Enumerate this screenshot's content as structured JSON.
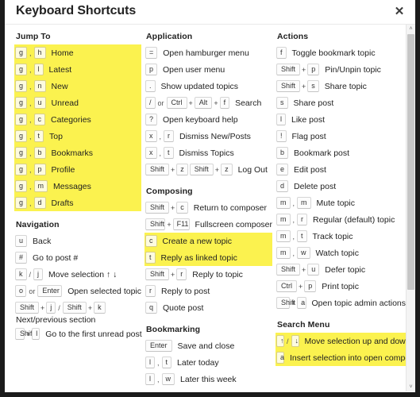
{
  "window": {
    "title": "Keyboard Shortcuts",
    "close_label": "✕",
    "scroll_up_icon": "˄",
    "scroll_down_icon": "˅"
  },
  "separators": {
    "comma": ",",
    "plus": "+",
    "slash": "/",
    "or": "or"
  },
  "columns": [
    {
      "name": "column-1",
      "sections": [
        {
          "title": "Jump To",
          "highlighted": true,
          "rows": [
            {
              "keys": [
                "g",
                "h"
              ],
              "sep": "comma",
              "label": "Home"
            },
            {
              "keys": [
                "g",
                "l"
              ],
              "sep": "comma",
              "label": "Latest"
            },
            {
              "keys": [
                "g",
                "n"
              ],
              "sep": "comma",
              "label": "New"
            },
            {
              "keys": [
                "g",
                "u"
              ],
              "sep": "comma",
              "label": "Unread"
            },
            {
              "keys": [
                "g",
                "c"
              ],
              "sep": "comma",
              "label": "Categories"
            },
            {
              "keys": [
                "g",
                "t"
              ],
              "sep": "comma",
              "label": "Top"
            },
            {
              "keys": [
                "g",
                "b"
              ],
              "sep": "comma",
              "label": "Bookmarks"
            },
            {
              "keys": [
                "g",
                "p"
              ],
              "sep": "comma",
              "label": "Profile"
            },
            {
              "keys": [
                "g",
                "m"
              ],
              "sep": "comma",
              "label": "Messages"
            },
            {
              "keys": [
                "g",
                "d"
              ],
              "sep": "comma",
              "label": "Drafts"
            }
          ]
        },
        {
          "title": "Navigation",
          "highlighted": false,
          "rows": [
            {
              "keys": [
                "u"
              ],
              "label": "Back"
            },
            {
              "keys": [
                "#"
              ],
              "label": "Go to post #"
            },
            {
              "keys": [
                "k",
                "j"
              ],
              "sep": "slash",
              "label": "Move selection ↑ ↓"
            },
            {
              "keys": [
                "o",
                "Enter"
              ],
              "sep": "or",
              "label": "Open selected topic"
            },
            {
              "keys": [
                "Shift",
                "j",
                "Shift",
                "k"
              ],
              "sep": "combo_slash",
              "label": "",
              "note": "Next/previous section"
            },
            {
              "keys": [
                "Shift",
                "l"
              ],
              "sep": "plus",
              "label": "Go to the first unread post"
            }
          ]
        }
      ]
    },
    {
      "name": "column-2",
      "sections": [
        {
          "title": "Application",
          "highlighted": false,
          "rows": [
            {
              "keys": [
                "="
              ],
              "label": "Open hamburger menu"
            },
            {
              "keys": [
                "p"
              ],
              "label": "Open user menu"
            },
            {
              "keys": [
                "."
              ],
              "label": "Show updated topics"
            },
            {
              "keys": [
                "/",
                "Ctrl",
                "Alt",
                "f"
              ],
              "sep": "search_combo",
              "label": "Search"
            },
            {
              "keys": [
                "?"
              ],
              "label": "Open keyboard help"
            },
            {
              "keys": [
                "x",
                "r"
              ],
              "sep": "comma",
              "label": "Dismiss New/Posts"
            },
            {
              "keys": [
                "x",
                "t"
              ],
              "sep": "comma",
              "label": "Dismiss Topics"
            },
            {
              "keys": [
                "Shift",
                "z",
                "Shift",
                "z"
              ],
              "sep": "logout_combo",
              "label": "Log Out"
            }
          ]
        },
        {
          "title": "Composing",
          "highlighted": false,
          "rows": [
            {
              "keys": [
                "Shift",
                "c"
              ],
              "sep": "plus",
              "label": "Return to composer"
            },
            {
              "keys": [
                "Shift",
                "F11"
              ],
              "sep": "plus",
              "label": "Fullscreen composer"
            },
            {
              "keys": [
                "c"
              ],
              "label": "Create a new topic",
              "highlight": true
            },
            {
              "keys": [
                "t"
              ],
              "label": "Reply as linked topic",
              "highlight": true
            },
            {
              "keys": [
                "Shift",
                "r"
              ],
              "sep": "plus",
              "label": "Reply to topic"
            },
            {
              "keys": [
                "r"
              ],
              "label": "Reply to post"
            },
            {
              "keys": [
                "q"
              ],
              "label": "Quote post"
            }
          ]
        },
        {
          "title": "Bookmarking",
          "highlighted": false,
          "rows": [
            {
              "keys": [
                "Enter"
              ],
              "label": "Save and close"
            },
            {
              "keys": [
                "l",
                "t"
              ],
              "sep": "comma",
              "label": "Later today"
            },
            {
              "keys": [
                "l",
                "w"
              ],
              "sep": "comma",
              "label": "Later this week"
            }
          ]
        }
      ]
    },
    {
      "name": "column-3",
      "sections": [
        {
          "title": "Actions",
          "highlighted": false,
          "rows": [
            {
              "keys": [
                "f"
              ],
              "label": "Toggle bookmark topic"
            },
            {
              "keys": [
                "Shift",
                "p"
              ],
              "sep": "plus",
              "label": "Pin/Unpin topic"
            },
            {
              "keys": [
                "Shift",
                "s"
              ],
              "sep": "plus",
              "label": "Share topic"
            },
            {
              "keys": [
                "s"
              ],
              "label": "Share post"
            },
            {
              "keys": [
                "l"
              ],
              "label": "Like post"
            },
            {
              "keys": [
                "!"
              ],
              "label": "Flag post"
            },
            {
              "keys": [
                "b"
              ],
              "label": "Bookmark post"
            },
            {
              "keys": [
                "e"
              ],
              "label": "Edit post"
            },
            {
              "keys": [
                "d"
              ],
              "label": "Delete post"
            },
            {
              "keys": [
                "m",
                "m"
              ],
              "sep": "comma",
              "label": "Mute topic"
            },
            {
              "keys": [
                "m",
                "r"
              ],
              "sep": "comma",
              "label": "Regular (default) topic"
            },
            {
              "keys": [
                "m",
                "t"
              ],
              "sep": "comma",
              "label": "Track topic"
            },
            {
              "keys": [
                "m",
                "w"
              ],
              "sep": "comma",
              "label": "Watch topic"
            },
            {
              "keys": [
                "Shift",
                "u"
              ],
              "sep": "plus",
              "label": "Defer topic"
            },
            {
              "keys": [
                "Ctrl",
                "p"
              ],
              "sep": "plus",
              "label": "Print topic"
            },
            {
              "keys": [
                "Shift",
                "a"
              ],
              "sep": "plus",
              "label": "Open topic admin actions"
            }
          ]
        },
        {
          "title": "Search Menu",
          "highlighted": true,
          "rows": [
            {
              "keys": [
                "↑",
                "↓"
              ],
              "sep": "slash",
              "label": "Move selection up and down"
            },
            {
              "keys": [
                "a"
              ],
              "label": "Insert selection into open composer"
            }
          ]
        }
      ]
    }
  ],
  "colors": {
    "highlight": "#fbf24f",
    "background": "#ffffff",
    "text": "#1f1f1f",
    "frame": "#1b1b1b"
  }
}
